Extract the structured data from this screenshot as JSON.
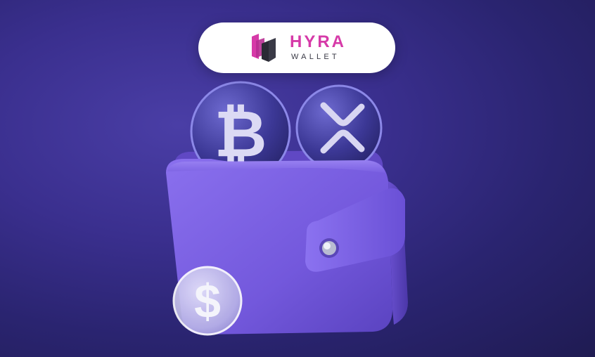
{
  "logo": {
    "brand_name": "HYRA",
    "brand_subtitle": "WALLET",
    "accent_color": "#d63aa8",
    "mark_color": "#2a2a34"
  },
  "illustration": {
    "background_color": "#2f2880",
    "wallet_color": "#7a5fe0",
    "coins": [
      {
        "icon": "bitcoin-symbol",
        "color": "#3f3aa0"
      },
      {
        "icon": "xrp-symbol",
        "color": "#3f3aa0"
      },
      {
        "icon": "dollar-symbol",
        "color": "#c9c6e8"
      }
    ]
  }
}
